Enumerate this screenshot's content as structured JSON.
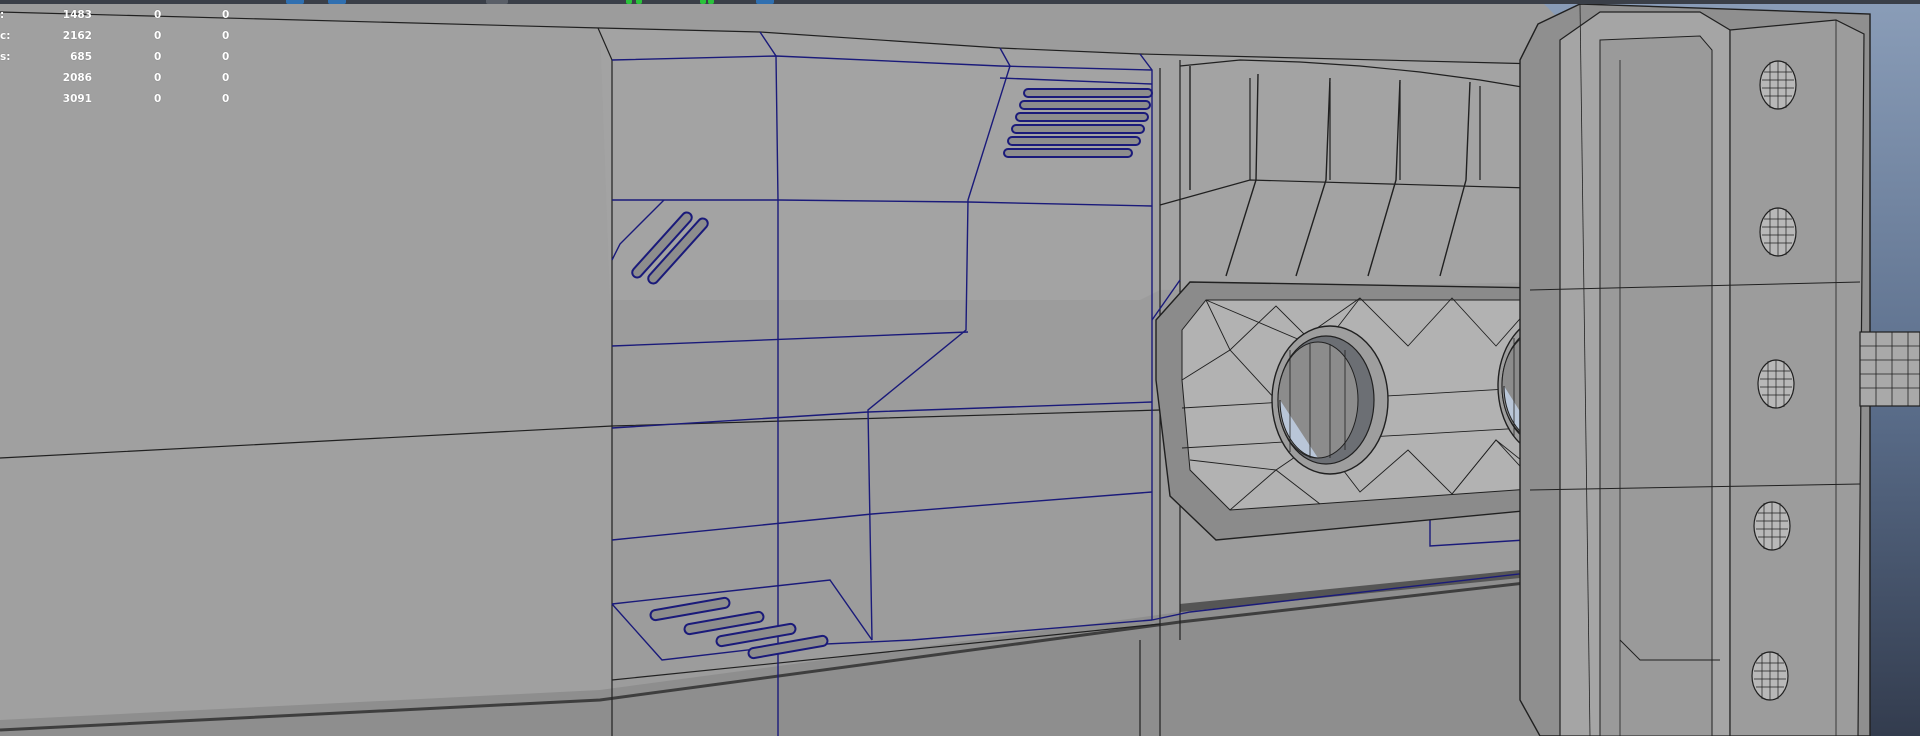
{
  "viewport": {
    "name": "3d-viewport",
    "background_colors": [
      "#8a9db8",
      "#333c4e"
    ],
    "mesh_color": "#9c9c9c",
    "wire_color": "#000000",
    "selected_edge_color": "#1a1a7a"
  },
  "toolbar_strip": {
    "accent_colors": [
      "#2f6fb0",
      "#29c33b"
    ]
  },
  "hud": {
    "rows": [
      {
        "label": ":",
        "values": [
          "1483",
          "0",
          "0"
        ]
      },
      {
        "label": "c:",
        "values": [
          "2162",
          "0",
          "0"
        ]
      },
      {
        "label": "s:",
        "values": [
          "685",
          "0",
          "0"
        ]
      },
      {
        "label": "",
        "values": [
          "2086",
          "0",
          "0"
        ]
      },
      {
        "label": "",
        "values": [
          "3091",
          "0",
          "0"
        ]
      }
    ]
  }
}
